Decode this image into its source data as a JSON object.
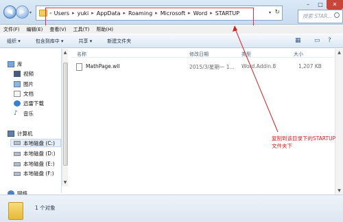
{
  "address_bar": {
    "path": [
      "Users",
      "yuki",
      "AppData",
      "Roaming",
      "Microsoft",
      "Word",
      "STARTUP"
    ],
    "search_placeholder": "搜索 STAR..."
  },
  "menu": [
    "文件(F)",
    "编辑(E)",
    "查看(V)",
    "工具(T)",
    "帮助(H)"
  ],
  "commands": [
    "组织 ▾",
    "包含到库中 ▾",
    "共享 ▾",
    "新建文件夹"
  ],
  "sidebar": {
    "library": "库",
    "library_items": [
      "视频",
      "图片",
      "文档",
      "迅雷下载",
      "音乐"
    ],
    "computer": "计算机",
    "drives": [
      "本地磁盘 (C:)",
      "本地磁盘 (D:)",
      "本地磁盘 (E:)",
      "本地磁盘 (F:)"
    ],
    "network": "网络"
  },
  "columns": {
    "name": "名称",
    "modified": "修改日期",
    "type": "类型",
    "size": "大小"
  },
  "files": [
    {
      "name": "MathPage.wll",
      "modified": "2015/3/星期一 1...",
      "type": "Word.Addin.8",
      "size": "1,207 KB"
    }
  ],
  "annotation": {
    "line1": "复制到该目录下的STARTUP",
    "line2": "文件夹下",
    "color": "#d12020"
  },
  "status": {
    "count": "1 个对象"
  }
}
